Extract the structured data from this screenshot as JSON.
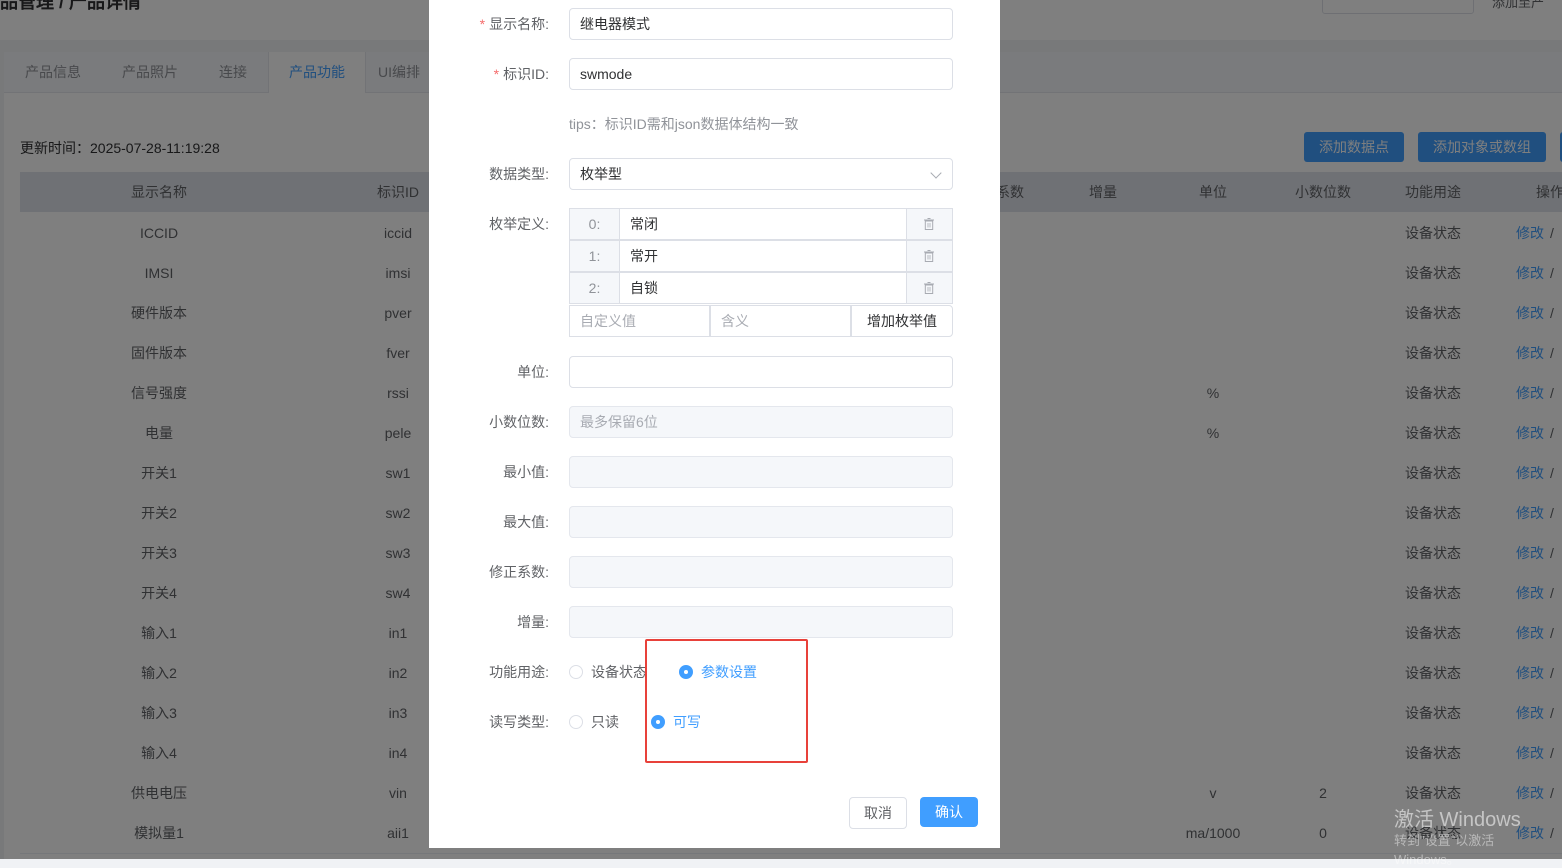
{
  "header": {
    "breadcrumb": "品管理 / 产品详情",
    "right_text": "添加至产"
  },
  "tabs": [
    {
      "label": "产品信息"
    },
    {
      "label": "产品照片"
    },
    {
      "label": "连接"
    },
    {
      "label": "产品功能"
    },
    {
      "label": "UI编排"
    }
  ],
  "update_time": "更新时间：2025-07-28-11:19:28",
  "buttons": {
    "add_datapoint": "添加数据点",
    "add_object": "添加对象或数组"
  },
  "table": {
    "headers": [
      "显示名称",
      "标识ID",
      "系数",
      "增量",
      "单位",
      "小数位数",
      "功能用途",
      "操作"
    ],
    "rows": [
      {
        "name": "ICCID",
        "id": "iccid",
        "unit": "",
        "decimals": "",
        "usage": "设备状态",
        "action": "修改"
      },
      {
        "name": "IMSI",
        "id": "imsi",
        "unit": "",
        "decimals": "",
        "usage": "设备状态",
        "action": "修改"
      },
      {
        "name": "硬件版本",
        "id": "pver",
        "unit": "",
        "decimals": "",
        "usage": "设备状态",
        "action": "修改"
      },
      {
        "name": "固件版本",
        "id": "fver",
        "unit": "",
        "decimals": "",
        "usage": "设备状态",
        "action": "修改"
      },
      {
        "name": "信号强度",
        "id": "rssi",
        "unit": "%",
        "decimals": "",
        "usage": "设备状态",
        "action": "修改"
      },
      {
        "name": "电量",
        "id": "pele",
        "unit": "%",
        "decimals": "",
        "usage": "设备状态",
        "action": "修改"
      },
      {
        "name": "开关1",
        "id": "sw1",
        "unit": "",
        "decimals": "",
        "usage": "设备状态",
        "action": "修改"
      },
      {
        "name": "开关2",
        "id": "sw2",
        "unit": "",
        "decimals": "",
        "usage": "设备状态",
        "action": "修改"
      },
      {
        "name": "开关3",
        "id": "sw3",
        "unit": "",
        "decimals": "",
        "usage": "设备状态",
        "action": "修改"
      },
      {
        "name": "开关4",
        "id": "sw4",
        "unit": "",
        "decimals": "",
        "usage": "设备状态",
        "action": "修改"
      },
      {
        "name": "输入1",
        "id": "in1",
        "unit": "",
        "decimals": "",
        "usage": "设备状态",
        "action": "修改"
      },
      {
        "name": "输入2",
        "id": "in2",
        "unit": "",
        "decimals": "",
        "usage": "设备状态",
        "action": "修改"
      },
      {
        "name": "输入3",
        "id": "in3",
        "unit": "",
        "decimals": "",
        "usage": "设备状态",
        "action": "修改"
      },
      {
        "name": "输入4",
        "id": "in4",
        "unit": "",
        "decimals": "",
        "usage": "设备状态",
        "action": "修改"
      },
      {
        "name": "供电电压",
        "id": "vin",
        "unit": "v",
        "decimals": "2",
        "usage": "设备状态",
        "action": "修改"
      },
      {
        "name": "模拟量1",
        "id": "aii1",
        "unit": "ma/1000",
        "decimals": "0",
        "usage": "设备状态",
        "action": "修改"
      }
    ]
  },
  "dialog": {
    "display_name": {
      "label": "显示名称:",
      "value": "继电器模式"
    },
    "identifier": {
      "label": "标识ID:",
      "value": "swmode"
    },
    "tips": "tips：标识ID需和json数据体结构一致",
    "data_type": {
      "label": "数据类型:",
      "value": "枚举型"
    },
    "enum_def": {
      "label": "枚举定义:",
      "items": [
        {
          "key": "0:",
          "value": "常闭"
        },
        {
          "key": "1:",
          "value": "常开"
        },
        {
          "key": "2:",
          "value": "自锁"
        }
      ],
      "custom_value_placeholder": "自定义值",
      "meaning_placeholder": "含义",
      "add_button": "增加枚举值"
    },
    "unit": {
      "label": "单位:",
      "value": ""
    },
    "decimals": {
      "label": "小数位数:",
      "placeholder": "最多保留6位"
    },
    "min": {
      "label": "最小值:"
    },
    "max": {
      "label": "最大值:"
    },
    "coefficient": {
      "label": "修正系数:"
    },
    "increment": {
      "label": "增量:"
    },
    "usage": {
      "label": "功能用途:",
      "options": [
        "设备状态",
        "参数设置"
      ],
      "selected": "参数设置"
    },
    "rw": {
      "label": "读写类型:",
      "options": [
        "只读",
        "可写"
      ],
      "selected": "可写"
    },
    "cancel": "取消",
    "confirm": "确认"
  },
  "watermark": {
    "line1": "激活 Windows",
    "line2": "转到\"设置\"以激活 Windows。"
  }
}
